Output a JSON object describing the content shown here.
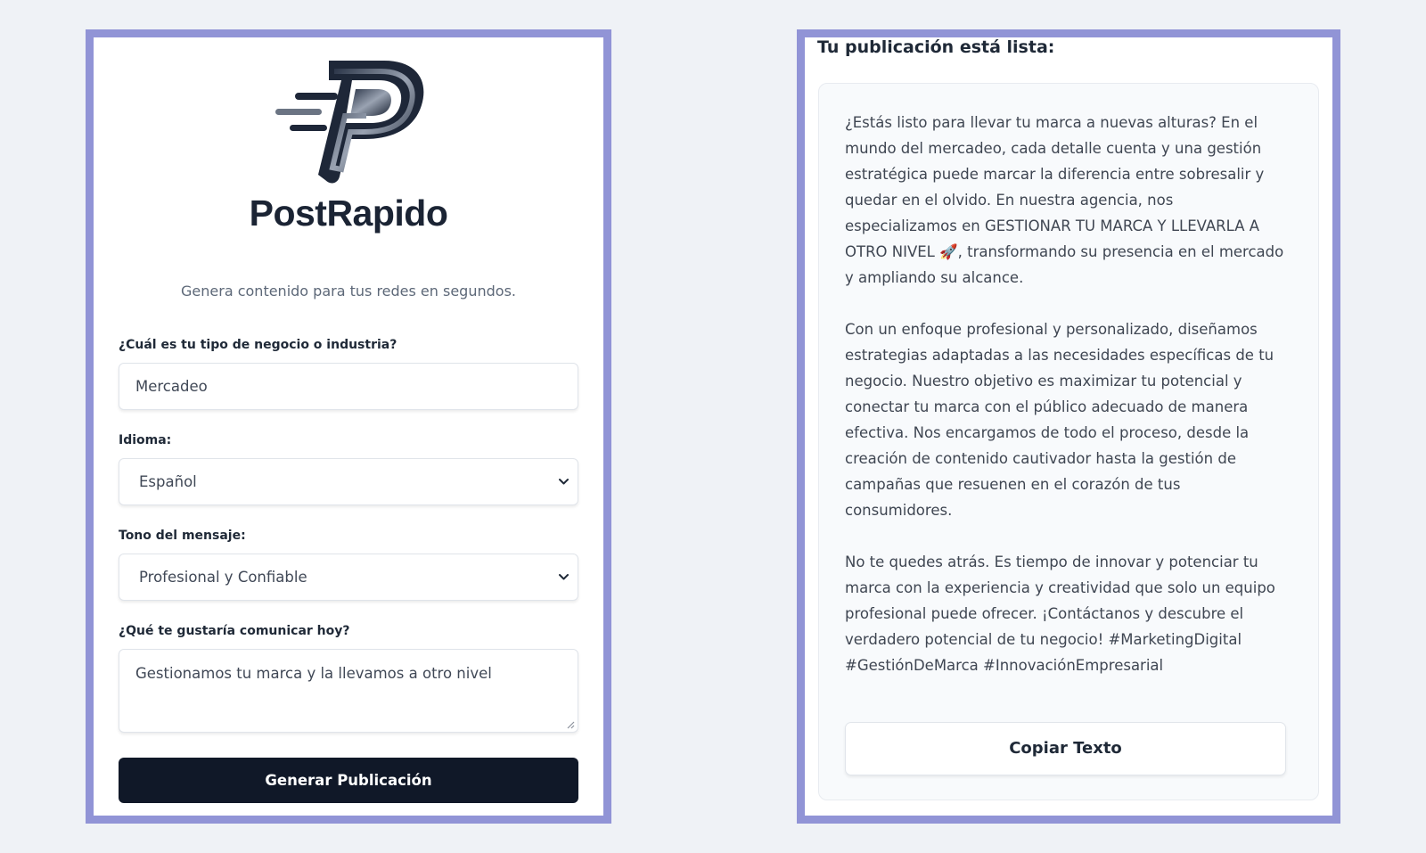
{
  "app": {
    "brand_name": "PostRapido",
    "tagline": "Genera contenido para tus redes en segundos."
  },
  "form": {
    "industry": {
      "label": "¿Cuál es tu tipo de negocio o industria?",
      "value": "Mercadeo"
    },
    "language": {
      "label": "Idioma:",
      "value": "Español"
    },
    "tone": {
      "label": "Tono del mensaje:",
      "value": "Profesional y Confiable"
    },
    "message": {
      "label": "¿Qué te gustaría comunicar hoy?",
      "value": "Gestionamos tu marca y la llevamos a otro nivel"
    },
    "submit_label": "Generar Publicación"
  },
  "result": {
    "title": "Tu publicación está lista:",
    "paragraphs": [
      "¿Estás listo para llevar tu marca a nuevas alturas? En el mundo del mercadeo, cada detalle cuenta y una gestión estratégica puede marcar la diferencia entre sobresalir y quedar en el olvido. En nuestra agencia, nos especializamos en GESTIONAR TU MARCA Y LLEVARLA A OTRO NIVEL 🚀, transformando su presencia en el mercado y ampliando su alcance.",
      "Con un enfoque profesional y personalizado, diseñamos estrategias adaptadas a las necesidades específicas de tu negocio. Nuestro objetivo es maximizar tu potencial y conectar tu marca con el público adecuado de manera efectiva. Nos encargamos de todo el proceso, desde la creación de contenido cautivador hasta la gestión de campañas que resuenen en el corazón de tus consumidores.",
      "No te quedes atrás. Es tiempo de innovar y potenciar tu marca con la experiencia y creatividad que solo un equipo profesional puede ofrecer. ¡Contáctanos y descubre el verdadero potencial de tu negocio! #MarketingDigital #GestiónDeMarca #InnovaciónEmpresarial"
    ],
    "copy_label": "Copiar Texto"
  },
  "icons": {
    "logo": "postrapido-logo-icon",
    "select_arrow": "chevron-down-icon",
    "resize": "resize-handle-icon"
  },
  "colors": {
    "panel_border": "#9194d6",
    "primary_button": "#101828",
    "page_background": "#eff2f6"
  }
}
